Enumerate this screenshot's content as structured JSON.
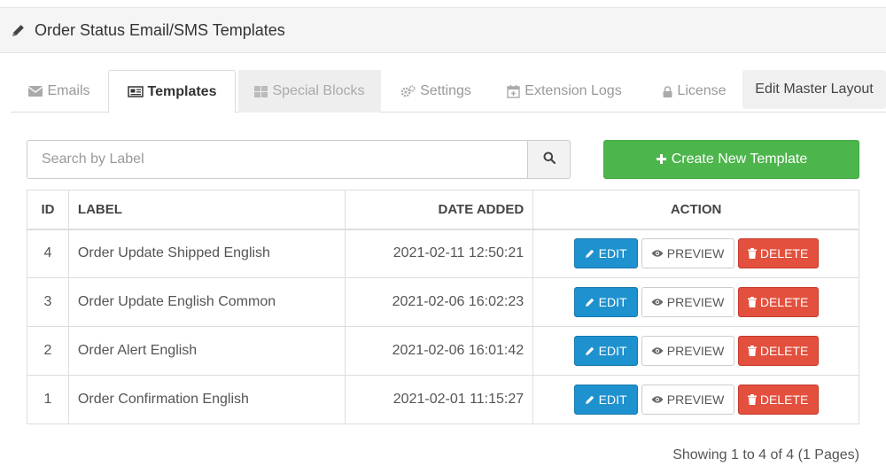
{
  "header": {
    "title": "Order Status Email/SMS Templates"
  },
  "tabs": [
    {
      "label": "Emails",
      "icon": "envelope-icon"
    },
    {
      "label": "Templates",
      "icon": "newspaper-icon"
    },
    {
      "label": "Special Blocks",
      "icon": "grid-icon"
    },
    {
      "label": "Settings",
      "icon": "gears-icon"
    },
    {
      "label": "Extension Logs",
      "icon": "calendar-plus-icon"
    },
    {
      "label": "License",
      "icon": "lock-icon"
    },
    {
      "label": "Edit Master Layout"
    }
  ],
  "search": {
    "placeholder": "Search by Label",
    "value": ""
  },
  "create_button": {
    "label": "Create New Template"
  },
  "table": {
    "headers": {
      "id": "ID",
      "label": "LABEL",
      "date": "DATE ADDED",
      "action": "ACTION"
    },
    "rows": [
      {
        "id": "4",
        "label": "Order Update Shipped English",
        "date": "2021-02-11 12:50:21"
      },
      {
        "id": "3",
        "label": "Order Update English Common",
        "date": "2021-02-06 16:02:23"
      },
      {
        "id": "2",
        "label": "Order Alert English",
        "date": "2021-02-06 16:01:42"
      },
      {
        "id": "1",
        "label": "Order Confirmation English",
        "date": "2021-02-01 11:15:27"
      }
    ],
    "actions": {
      "edit": "EDIT",
      "preview": "PREVIEW",
      "delete": "DELETE"
    }
  },
  "pagination": {
    "info": "Showing 1 to 4 of 4 (1 Pages)"
  },
  "colors": {
    "edit": "#1e91cf",
    "delete": "#e3503e",
    "create": "#4cb64c"
  }
}
